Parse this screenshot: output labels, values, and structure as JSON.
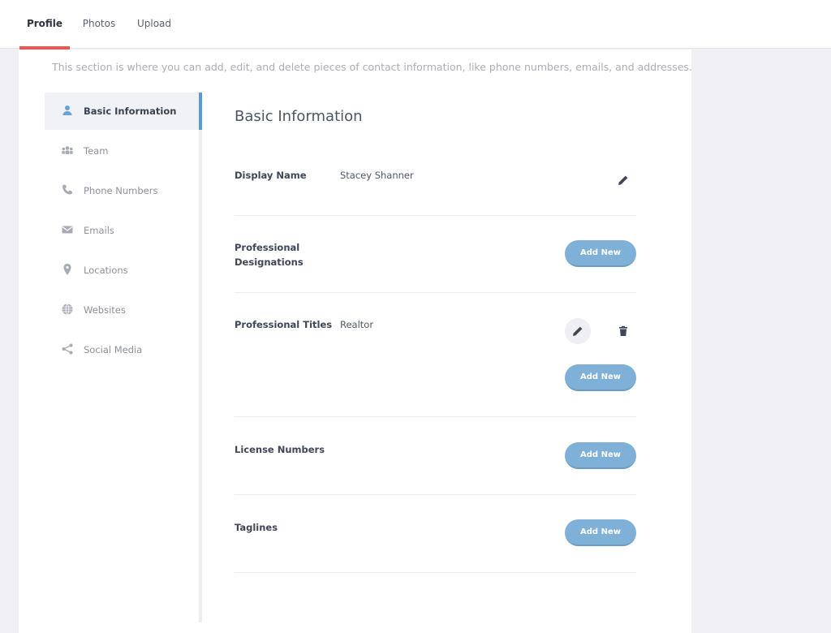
{
  "tabs": [
    {
      "label": "Profile",
      "active": true
    },
    {
      "label": "Photos",
      "active": false
    },
    {
      "label": "Upload",
      "active": false
    }
  ],
  "intro": "This section is where you can add, edit, and delete pieces of contact information, like phone numbers, emails, and addresses.",
  "sidebar": {
    "items": [
      {
        "label": "Basic Information",
        "icon": "person-icon",
        "active": true
      },
      {
        "label": "Team",
        "icon": "team-icon",
        "active": false
      },
      {
        "label": "Phone Numbers",
        "icon": "phone-icon",
        "active": false
      },
      {
        "label": "Emails",
        "icon": "envelope-icon",
        "active": false
      },
      {
        "label": "Locations",
        "icon": "location-pin-icon",
        "active": false
      },
      {
        "label": "Websites",
        "icon": "globe-icon",
        "active": false
      },
      {
        "label": "Social Media",
        "icon": "share-icon",
        "active": false
      }
    ]
  },
  "main": {
    "title": "Basic Information",
    "display_name": {
      "label": "Display Name",
      "value": "Stacey Shanner"
    },
    "designations": {
      "label": "Professional Designations",
      "button": "Add New"
    },
    "titles": {
      "label": "Professional Titles",
      "value": "Realtor",
      "button": "Add New"
    },
    "license": {
      "label": "License Numbers",
      "button": "Add New"
    },
    "taglines": {
      "label": "Taglines",
      "button": "Add New"
    }
  },
  "colors": {
    "accent": "#f25252",
    "primary_button": "#7fb0d8",
    "active_indicator": "#5b9bd5",
    "background": "#f0f0f4"
  }
}
